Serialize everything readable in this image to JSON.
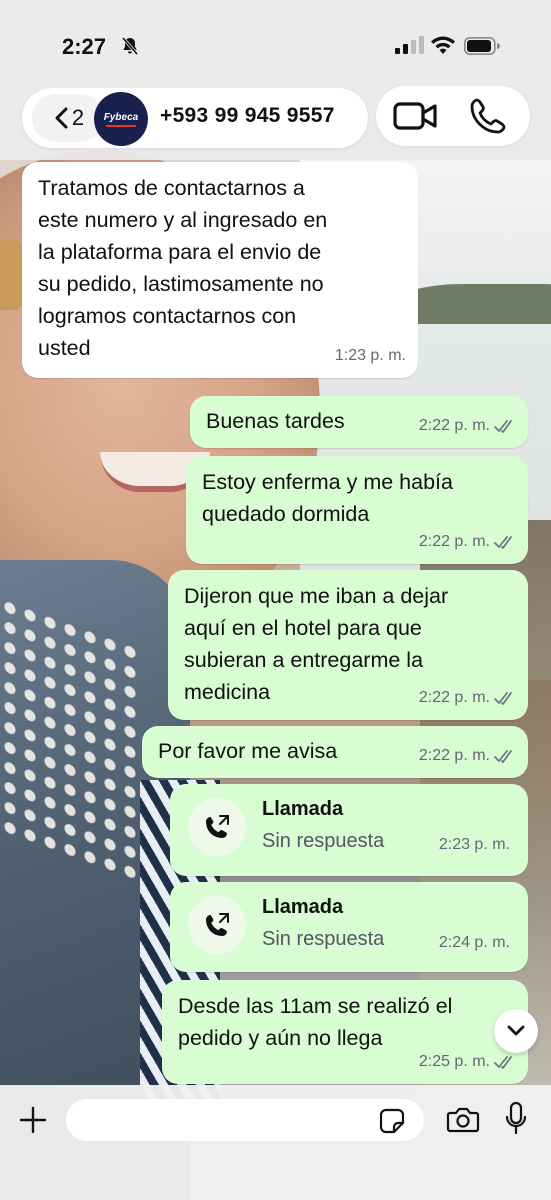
{
  "status_bar": {
    "time": "2:27",
    "icons": [
      "bell-slash-icon",
      "cellular-signal-icon",
      "wifi-icon",
      "battery-icon"
    ]
  },
  "header": {
    "back_count": "2",
    "avatar_text": "Fybeca",
    "contact_name": "+593 99 945 9557",
    "icons": [
      "chevron-left-icon",
      "video-call-icon",
      "phone-icon"
    ]
  },
  "messages": [
    {
      "direction": "incoming",
      "text": "Tratamos de contactarnos a\neste numero y al ingresado en\nla plataforma para el envio de\nsu pedido, lastimosamente no\nlogramos contactarnos con\nusted",
      "time": "1:23 p. m."
    },
    {
      "direction": "outgoing",
      "text": "Buenas tardes",
      "time": "2:22 p. m.",
      "status": "read"
    },
    {
      "direction": "outgoing",
      "text": "Estoy enferma y me había\nquedado dormida",
      "time": "2:22 p. m.",
      "status": "read"
    },
    {
      "direction": "outgoing",
      "text": "Dijeron que me iban a dejar\naquí en el hotel para que\nsubieran a entregarme la\nmedicina",
      "time": "2:22 p. m.",
      "status": "read"
    },
    {
      "direction": "outgoing",
      "text": "Por favor me avisa",
      "time": "2:22 p. m.",
      "status": "read"
    },
    {
      "direction": "outgoing",
      "type": "call",
      "title": "Llamada",
      "subtitle": "Sin respuesta",
      "time": "2:23 p. m."
    },
    {
      "direction": "outgoing",
      "type": "call",
      "title": "Llamada",
      "subtitle": "Sin respuesta",
      "time": "2:24 p. m."
    },
    {
      "direction": "outgoing",
      "text": "Desde las 11am se realizó el\npedido y aún no llega",
      "time": "2:25 p. m.",
      "status": "read"
    }
  ],
  "input_bar": {
    "placeholder": "",
    "icons": [
      "plus-icon",
      "sticker-icon",
      "camera-icon",
      "microphone-icon"
    ]
  },
  "colors": {
    "incoming_bubble": "#ffffff",
    "outgoing_bubble": "#d9fdd3",
    "read_ticks": "#6b7785",
    "avatar_bg": "#19204d"
  }
}
